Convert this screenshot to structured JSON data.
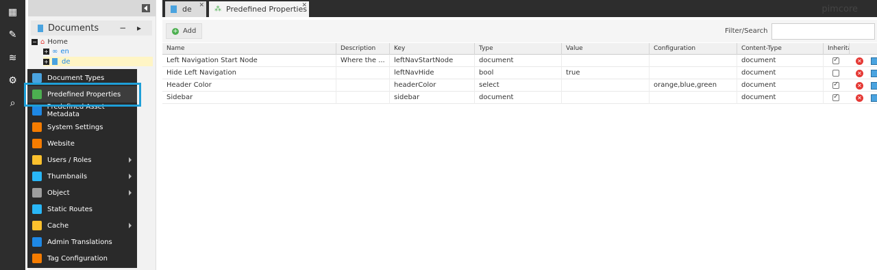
{
  "tree": {
    "title": "Documents",
    "header_btns": "− ▸",
    "nodes": [
      {
        "label": "Home"
      },
      {
        "label": "en"
      },
      {
        "label": "de"
      }
    ]
  },
  "tabs": [
    {
      "label": "de"
    },
    {
      "label": "Predefined Properties"
    }
  ],
  "brand": "pimcore",
  "toolbar": {
    "add_label": "Add",
    "filter_label": "Filter/Search",
    "filter_value": ""
  },
  "grid": {
    "columns": [
      "Name",
      "Description",
      "Key",
      "Type",
      "Value",
      "Configuration",
      "Content-Type",
      "Inherita"
    ],
    "rows": [
      {
        "name": "Left Navigation Start Node",
        "description": "Where the ...",
        "key": "leftNavStartNode",
        "type": "document",
        "value": "",
        "configuration": "",
        "content_type": "document",
        "inheritable": true
      },
      {
        "name": "Hide Left Navigation",
        "description": "",
        "key": "leftNavHide",
        "type": "bool",
        "value": "true",
        "configuration": "",
        "content_type": "document",
        "inheritable": false
      },
      {
        "name": "Header Color",
        "description": "",
        "key": "headerColor",
        "type": "select",
        "value": "",
        "configuration": "orange,blue,green",
        "content_type": "document",
        "inheritable": true
      },
      {
        "name": "Sidebar",
        "description": "",
        "key": "sidebar",
        "type": "document",
        "value": "",
        "configuration": "",
        "content_type": "document",
        "inheritable": true
      }
    ]
  },
  "menu": {
    "items": [
      {
        "label": "Document Types",
        "color": "#4aa3df",
        "submenu": false
      },
      {
        "label": "Predefined Properties",
        "color": "#4caf50",
        "submenu": false
      },
      {
        "label": "Predefined Asset Metadata",
        "color": "#1e88e5",
        "submenu": false
      },
      {
        "label": "System Settings",
        "color": "#f57c00",
        "submenu": false
      },
      {
        "label": "Website",
        "color": "#f57c00",
        "submenu": false
      },
      {
        "label": "Users / Roles",
        "color": "#fbc02d",
        "submenu": true
      },
      {
        "label": "Thumbnails",
        "color": "#29b6f6",
        "submenu": true
      },
      {
        "label": "Object",
        "color": "#9e9e9e",
        "submenu": true
      },
      {
        "label": "Static Routes",
        "color": "#29b6f6",
        "submenu": false
      },
      {
        "label": "Cache",
        "color": "#fbc02d",
        "submenu": true
      },
      {
        "label": "Admin Translations",
        "color": "#1e88e5",
        "submenu": false
      },
      {
        "label": "Tag Configuration",
        "color": "#f57c00",
        "submenu": false
      }
    ]
  }
}
